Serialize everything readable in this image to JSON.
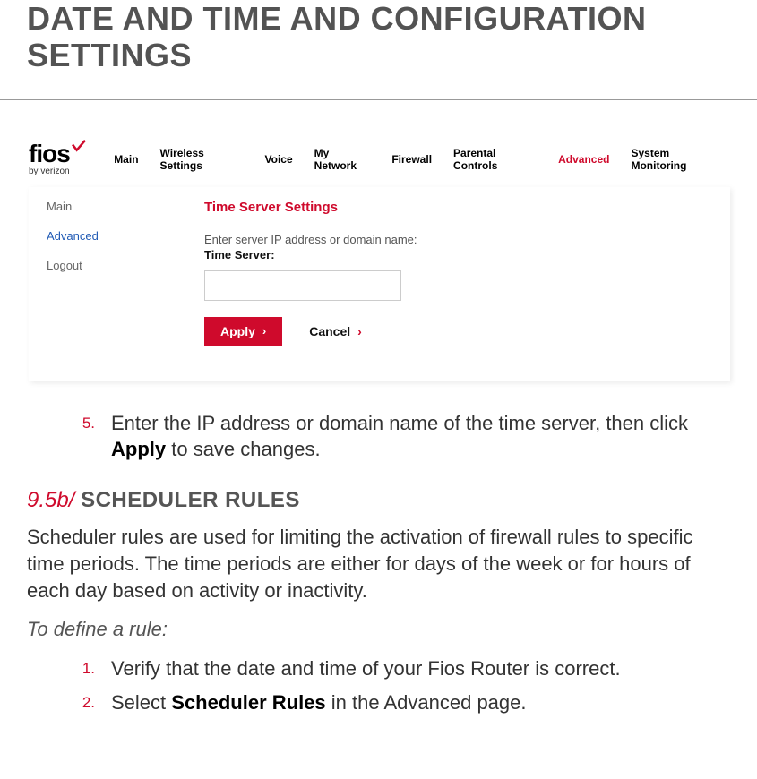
{
  "page": {
    "title": "DATE AND TIME AND CONFIGURATION SETTINGS"
  },
  "router": {
    "logo": {
      "word": "fios",
      "sub": "by verizon"
    },
    "topTabs": [
      {
        "label": "Main",
        "active": false
      },
      {
        "label": "Wireless Settings",
        "active": false
      },
      {
        "label": "Voice",
        "active": false
      },
      {
        "label": "My Network",
        "active": false
      },
      {
        "label": "Firewall",
        "active": false
      },
      {
        "label": "Parental Controls",
        "active": false
      },
      {
        "label": "Advanced",
        "active": true
      },
      {
        "label": "System Monitoring",
        "active": false
      }
    ],
    "sidebar": [
      {
        "label": "Main",
        "active": false
      },
      {
        "label": "Advanced",
        "active": true
      },
      {
        "label": "Logout",
        "active": false
      }
    ],
    "panel": {
      "heading": "Time Server Settings",
      "desc": "Enter server IP address or domain name:",
      "fieldLabel": "Time Server:",
      "fieldValue": "",
      "applyLabel": "Apply",
      "cancelLabel": "Cancel"
    }
  },
  "doc": {
    "step5": {
      "num": "5.",
      "pre": "Enter the IP address or domain name of the time server, then click ",
      "bold": "Apply",
      "post": " to save changes."
    },
    "section": {
      "num": "9.5b/",
      "name": "SCHEDULER RULES"
    },
    "intro": "Scheduler rules are used for limiting the activation of firewall rules to specific time periods. The time periods are either for days of the week or for hours of each day based on activity or inactivity.",
    "lead": "To define a rule:",
    "step1": {
      "num": "1.",
      "text": "Verify that the date and time of your Fios Router is correct."
    },
    "step2": {
      "num": "2.",
      "pre": "Select ",
      "bold": "Scheduler Rules",
      "post": " in the Advanced page."
    }
  }
}
